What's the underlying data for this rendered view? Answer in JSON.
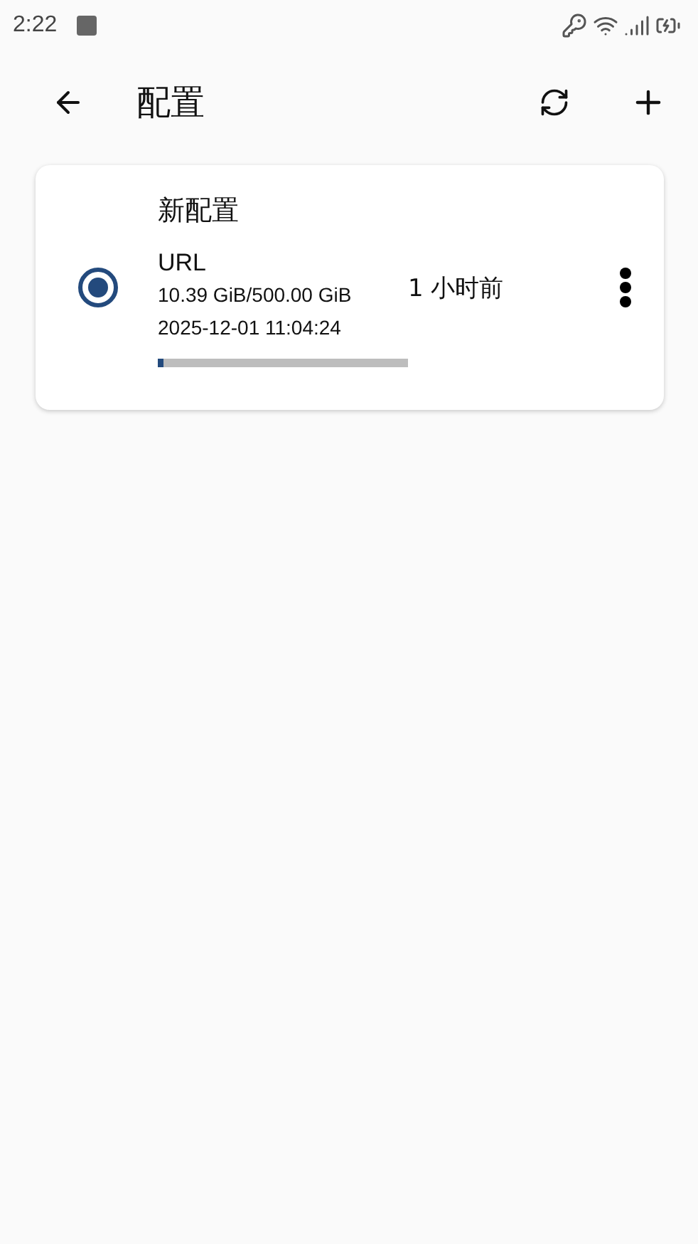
{
  "status_bar": {
    "time": "2:22"
  },
  "app_bar": {
    "title": "配置"
  },
  "profiles": [
    {
      "name": "新配置",
      "type": "URL",
      "usage": "10.39 GiB/500.00 GiB",
      "expiry": "2025-12-01 11:04:24",
      "level": 0.021,
      "updated": "1 小时前",
      "selected": true
    }
  ]
}
